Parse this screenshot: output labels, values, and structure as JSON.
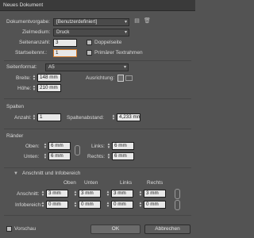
{
  "window": {
    "title": "Neues Dokument"
  },
  "preset": {
    "label": "Dokumentvorgabe:",
    "value": "[Benutzerdefiniert]"
  },
  "intent": {
    "label": "Zielmedium:",
    "value": "Druck"
  },
  "pages": {
    "label": "Seitenanzahl:",
    "value": "3"
  },
  "facing": {
    "label": "Doppelseite",
    "checked": false
  },
  "start": {
    "label": "Startseitennr.:",
    "value": "1"
  },
  "primary_text": {
    "label": "Primärer Textrahmen",
    "checked": false
  },
  "page_size": {
    "label": "Seitenformat:",
    "value": "A5"
  },
  "width": {
    "label": "Breite:",
    "value": "148 mm"
  },
  "height": {
    "label": "Höhe:",
    "value": "210 mm"
  },
  "orientation": {
    "label": "Ausrichtung:"
  },
  "columns": {
    "title": "Spalten",
    "count_label": "Anzahl:",
    "count": "1",
    "gutter_label": "Spaltenabstand:",
    "gutter": "4,233 mm"
  },
  "margins": {
    "title": "Ränder",
    "top_label": "Oben:",
    "top": "6 mm",
    "bottom_label": "Unten:",
    "bottom": "6 mm",
    "left_label": "Links:",
    "left": "6 mm",
    "right_label": "Rechts:",
    "right": "6 mm"
  },
  "bleed": {
    "title": "Anschnitt und Infobereich",
    "headers": [
      "Oben",
      "Unten",
      "Links",
      "Rechts"
    ],
    "bleed_label": "Anschnitt:",
    "bleed_values": [
      "3 mm",
      "3 mm",
      "3 mm",
      "3 mm"
    ],
    "slug_label": "Infobereich:",
    "slug_values": [
      "0 mm",
      "0 mm",
      "0 mm",
      "0 mm"
    ]
  },
  "footer": {
    "preview": "Vorschau",
    "ok": "OK",
    "cancel": "Abbrechen"
  }
}
